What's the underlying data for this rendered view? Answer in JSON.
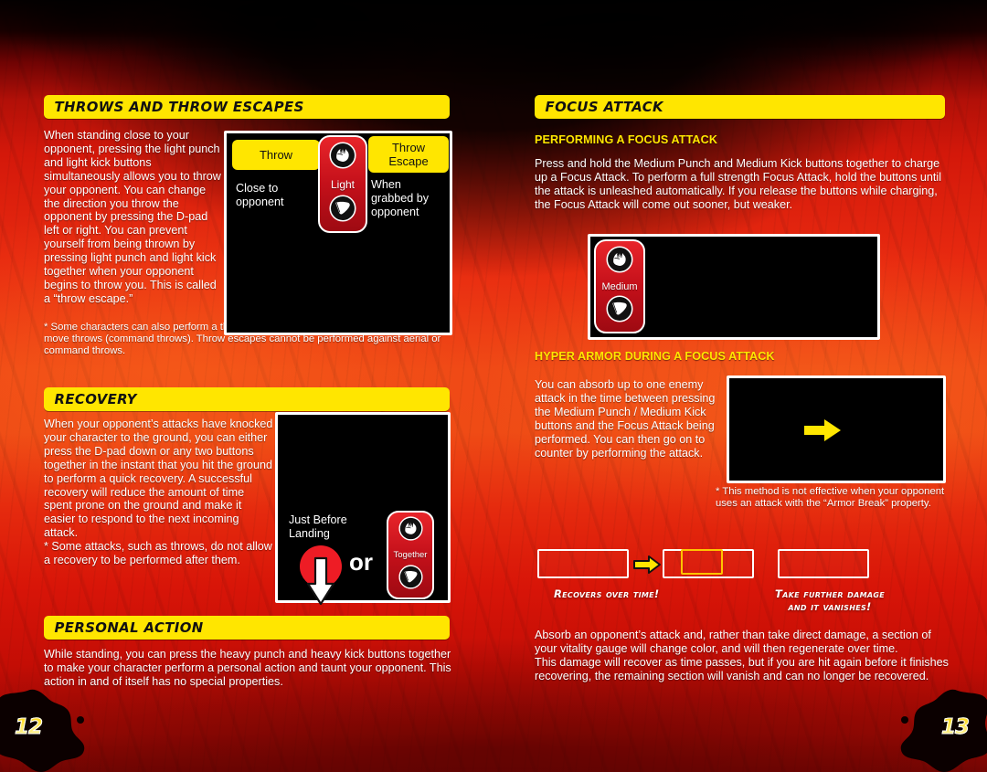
{
  "background": {
    "top_color": "#000000",
    "mid_color": "#f04a16",
    "bottom_color": "#a80a04",
    "accent_yellow": "#ffe600"
  },
  "left_page": {
    "page_number": "12",
    "sections": [
      {
        "id": "throws",
        "heading": "THROWS AND THROW ESCAPES",
        "body": "When standing close to your opponent, pressing the light punch and light kick buttons simultaneously allows you to throw your opponent. You can change the direction you throw the opponent by pressing the D-pad left or right. You can prevent yourself from being thrown by pressing light punch and light kick together when your opponent begins to throw you. This is called a “throw escape.”",
        "note": "* Some characters can also perform a throw when jumping (aerial throw), or special move throws (command throws). Throw escapes cannot be performed against aerial or command throws.",
        "diagram": {
          "left_chip": "Throw",
          "left_text": "Close to\nopponent",
          "right_chip": "Throw\nEscape",
          "right_text": "When\ngrabbed by\nopponent",
          "button_label": "Light",
          "button_icons": [
            "punch-fist-icon",
            "kick-foot-icon"
          ]
        }
      },
      {
        "id": "recovery",
        "heading": "RECOVERY",
        "body": "When your opponent’s attacks have knocked your character to the ground, you can either press the D-pad down or any two buttons together in the instant that you hit the ground to perform a quick recovery. A successful recovery will reduce the amount of time spent prone on the ground and make it easier to respond to the next incoming attack.\n* Some attacks, such as throws, do not allow a recovery to be performed after them.",
        "diagram": {
          "caption": "Just Before\nLanding",
          "or_label": "or",
          "button_label": "Together",
          "button_icons": [
            "punch-fist-icon",
            "kick-foot-icon"
          ],
          "dpad_icon": "dpad-down-arrow-icon"
        }
      },
      {
        "id": "personal-action",
        "heading": "PERSONAL ACTION",
        "body": "While standing, you can press the heavy punch and heavy kick buttons together to make your character perform a personal action and taunt your opponent. This action in and of itself has no special properties."
      }
    ]
  },
  "right_page": {
    "page_number": "13",
    "heading": "FOCUS ATTACK",
    "sections": [
      {
        "id": "performing",
        "subheading": "PERFORMING A FOCUS ATTACK",
        "body": "Press and hold the Medium Punch and Medium Kick buttons together to charge up a Focus Attack. To perform a full strength Focus Attack, hold the buttons until the attack is unleashed automatically. If you release the buttons while charging, the Focus Attack will come out sooner, but weaker.",
        "diagram": {
          "button_label": "Medium",
          "button_icons": [
            "punch-fist-icon",
            "kick-foot-icon"
          ]
        }
      },
      {
        "id": "hyper-armor",
        "subheading": "HYPER ARMOR DURING A FOCUS ATTACK",
        "body": "You can absorb up to one enemy attack in the time between pressing the Medium Punch / Medium Kick buttons and the Focus Attack being performed. You can then go on to counter by performing the attack.",
        "note": "* This method is not effective when your opponent uses an attack with the “Armor Break” property.",
        "diagram": {
          "arrow_icon": "yellow-right-arrow-icon"
        }
      }
    ],
    "gauge_diagram": {
      "arrow_icon": "yellow-right-arrow-icon",
      "caption_left": "Recovers over time!",
      "caption_right": "Take further damage\nand it vanishes!",
      "gauge_border_color": "#ffffff",
      "highlight_color": "#ffc400"
    },
    "footer_body": "Absorb an opponent’s attack and, rather than take direct damage, a section of your vitality gauge will change color, and will then regenerate over time.\nThis damage will recover as time passes, but if you are hit again before it finishes recovering, the remaining section will vanish and can no longer be recovered."
  }
}
